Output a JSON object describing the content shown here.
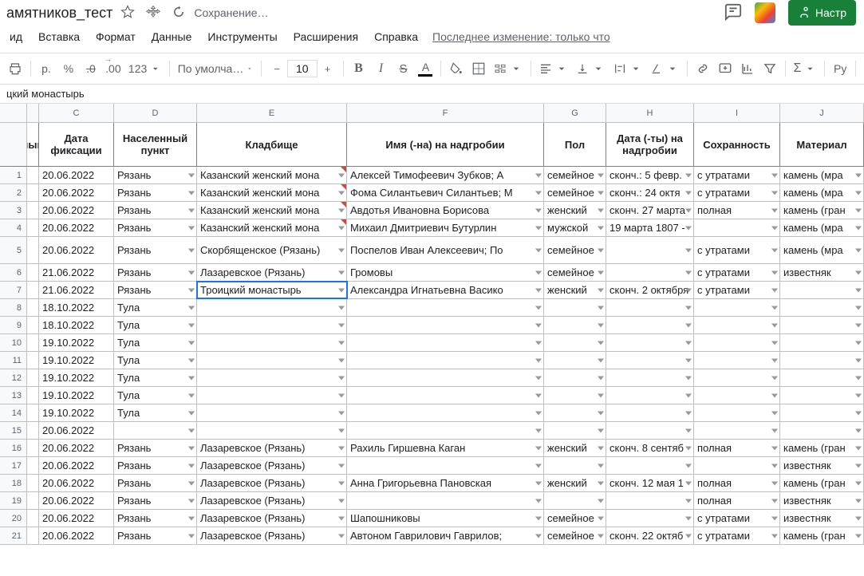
{
  "doc_title": "амятников_тест",
  "saving": "Сохранение…",
  "share_label": "Настр",
  "last_edit": "Последнее изменение: только что",
  "menus": [
    "ид",
    "Вставка",
    "Формат",
    "Данные",
    "Инструменты",
    "Расширения",
    "Справка"
  ],
  "toolbar": {
    "currency": "р.",
    "percent": "%",
    "dec_dec": ".0",
    "dec_inc": ".00",
    "num_format": "123",
    "font": "По умолча…",
    "font_size": "10",
    "bold": "B",
    "italic": "I",
    "strike": "S",
    "sigma": "Σ",
    "ru": "Ру"
  },
  "formula_bar": "цкий монастырь",
  "col_letters": [
    "",
    "C",
    "D",
    "E",
    "F",
    "G",
    "H",
    "I",
    "J"
  ],
  "headers": [
    "ный",
    "Дата фиксации",
    "Населенный пункт",
    "Кладбище",
    "Имя (-на) на надгробии",
    "Пол",
    "Дата (-ты) на надгробии",
    "Сохранность",
    "Материал"
  ],
  "rows": [
    {
      "n": "1",
      "c": "20.06.2022",
      "d": "Рязань",
      "e": "Казанский женский мона",
      "f": "Алексей Тимофеевич Зубков; А",
      "g": "семейное",
      "h": "сконч.: 5 февр.",
      "i": "с утратами",
      "j": "камень (мра",
      "mark": true
    },
    {
      "n": "2",
      "c": "20.06.2022",
      "d": "Рязань",
      "e": "Казанский женский мона",
      "f": "Фома Силантьевич Силантьев; М",
      "g": "семейное",
      "h": "сконч.: 24 октя",
      "i": "с утратами",
      "j": "камень (мра",
      "mark": true
    },
    {
      "n": "3",
      "c": "20.06.2022",
      "d": "Рязань",
      "e": "Казанский женский мона",
      "f": "Авдотья Ивановна Борисова",
      "g": "женский",
      "h": "сконч. 27 марта",
      "i": "полная",
      "j": "камень (гран",
      "mark": true
    },
    {
      "n": "4",
      "c": "20.06.2022",
      "d": "Рязань",
      "e": "Казанский женский мона",
      "f": "Михаил Дмитриевич Бутурлин",
      "g": "мужской",
      "h": "19 марта 1807 -",
      "i": "",
      "j": "камень (мра",
      "mark": true
    },
    {
      "n": "5",
      "c": "20.06.2022",
      "d": "Рязань",
      "e": "Скорбященское (Рязань)",
      "f": "Поспелов Иван Алексеевич; По",
      "g": "семейное",
      "h": "",
      "i": "с утратами",
      "j": "камень (мра",
      "tall": true
    },
    {
      "n": "6",
      "c": "21.06.2022",
      "d": "Рязань",
      "e": "Лазаревское (Рязань)",
      "f": "Громовы",
      "g": "семейное",
      "h": "",
      "i": "с утратами",
      "j": "известняк"
    },
    {
      "n": "7",
      "c": "21.06.2022",
      "d": "Рязань",
      "e": "Троицкий монастырь",
      "f": "Александра Игнатьевна Васико",
      "g": "женский",
      "h": "сконч. 2 октября",
      "i": "с утратами",
      "j": "",
      "active": true
    },
    {
      "n": "8",
      "c": "18.10.2022",
      "d": "Тула",
      "e": "",
      "f": "",
      "g": "",
      "h": "",
      "i": "",
      "j": ""
    },
    {
      "n": "9",
      "c": "18.10.2022",
      "d": "Тула",
      "e": "",
      "f": "",
      "g": "",
      "h": "",
      "i": "",
      "j": ""
    },
    {
      "n": "10",
      "c": "19.10.2022",
      "d": "Тула",
      "e": "",
      "f": "",
      "g": "",
      "h": "",
      "i": "",
      "j": ""
    },
    {
      "n": "11",
      "c": "19.10.2022",
      "d": "Тула",
      "e": "",
      "f": "",
      "g": "",
      "h": "",
      "i": "",
      "j": ""
    },
    {
      "n": "12",
      "c": "19.10.2022",
      "d": "Тула",
      "e": "",
      "f": "",
      "g": "",
      "h": "",
      "i": "",
      "j": ""
    },
    {
      "n": "13",
      "c": "19.10.2022",
      "d": "Тула",
      "e": "",
      "f": "",
      "g": "",
      "h": "",
      "i": "",
      "j": ""
    },
    {
      "n": "14",
      "c": "19.10.2022",
      "d": "Тула",
      "e": "",
      "f": "",
      "g": "",
      "h": "",
      "i": "",
      "j": ""
    },
    {
      "n": "15",
      "c": "20.06.2022",
      "d": "",
      "e": "",
      "f": "",
      "g": "",
      "h": "",
      "i": "",
      "j": ""
    },
    {
      "n": "16",
      "c": "20.06.2022",
      "d": "Рязань",
      "e": "Лазаревское (Рязань)",
      "f": "Рахиль Гиршевна Каган",
      "g": "женский",
      "h": "сконч. 8 сентяб",
      "i": "полная",
      "j": "камень (гран"
    },
    {
      "n": "17",
      "c": "20.06.2022",
      "d": "Рязань",
      "e": "Лазаревское (Рязань)",
      "f": "",
      "g": "",
      "h": "",
      "i": "",
      "j": "известняк"
    },
    {
      "n": "18",
      "c": "20.06.2022",
      "d": "Рязань",
      "e": "Лазаревское (Рязань)",
      "f": "Анна Григорьевна Пановская",
      "g": "женский",
      "h": "сконч. 12 мая 1",
      "i": "полная",
      "j": "камень (гран"
    },
    {
      "n": "19",
      "c": "20.06.2022",
      "d": "Рязань",
      "e": "Лазаревское (Рязань)",
      "f": "",
      "g": "",
      "h": "",
      "i": "полная",
      "j": "известняк"
    },
    {
      "n": "20",
      "c": "20.06.2022",
      "d": "Рязань",
      "e": "Лазаревское (Рязань)",
      "f": "Шапошниковы",
      "g": "семейное",
      "h": "",
      "i": "с утратами",
      "j": "известняк"
    },
    {
      "n": "21",
      "c": "20.06.2022",
      "d": "Рязань",
      "e": "Лазаревское (Рязань)",
      "f": "Автоном Гаврилович Гаврилов;",
      "g": "семейное",
      "h": "сконч. 22 октяб",
      "i": "с утратами",
      "j": "камень (гран"
    }
  ]
}
